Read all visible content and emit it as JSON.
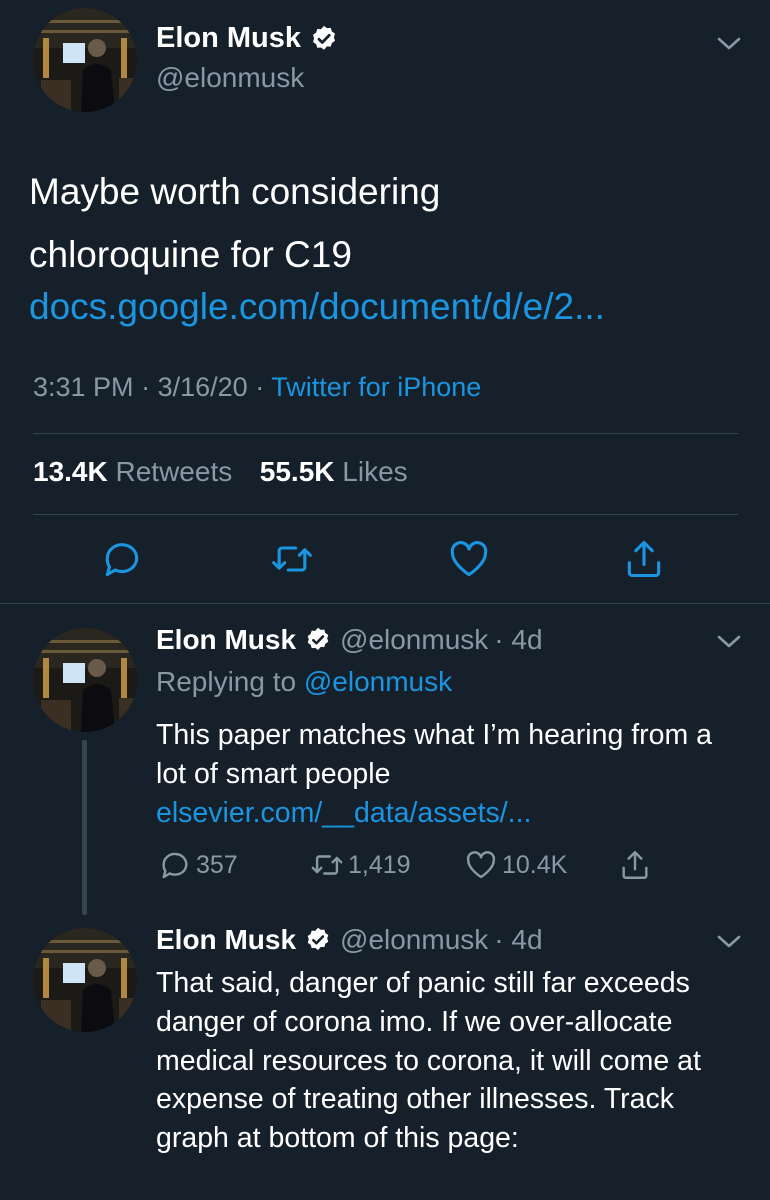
{
  "main_tweet": {
    "name": "Elon Musk",
    "handle": "@elonmusk",
    "text_line1": "Maybe worth considering",
    "text_line2": "chloroquine for C19",
    "link": "docs.google.com/document/d/e/2...",
    "time": "3:31 PM",
    "sep1": "·",
    "date": "3/16/20",
    "sep2": "·",
    "source": "Twitter for iPhone",
    "retweets_count": "13.4K",
    "retweets_label": "Retweets",
    "likes_count": "55.5K",
    "likes_label": "Likes"
  },
  "reply1": {
    "name": "Elon Musk",
    "handle": "@elonmusk",
    "age": "· 4d",
    "replying_label": "Replying to",
    "replying_to": "@elonmusk",
    "text": "This paper matches what I’m hearing from a lot of smart people ",
    "link": "elsevier.com/__data/assets/...",
    "reply_count": "357",
    "retweet_count": "1,419",
    "like_count": "10.4K"
  },
  "reply2": {
    "name": "Elon Musk",
    "handle": "@elonmusk",
    "age": "· 4d",
    "text": "That said, danger of panic still far exceeds danger of corona imo. If we over-allocate medical resources to corona, it will come at expense of treating other illnesses. Track graph at bottom of this page:"
  },
  "icons": {
    "reply": "reply-icon",
    "retweet": "retweet-icon",
    "like": "heart-icon",
    "share": "share-icon",
    "verified": "verified-badge-icon",
    "menu": "chevron-down-icon"
  },
  "colors": {
    "background": "#15202b",
    "link": "#1b95e0",
    "secondary_text": "#8899a6",
    "divider": "#38444d"
  }
}
